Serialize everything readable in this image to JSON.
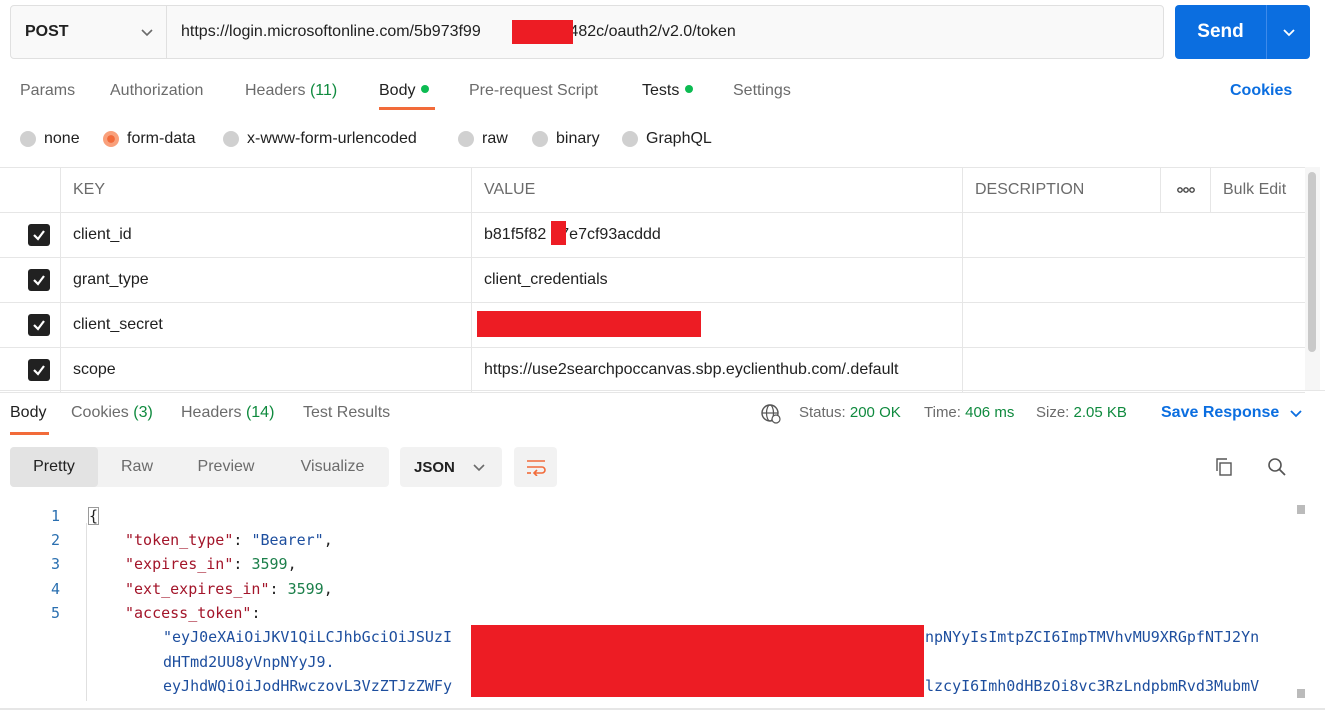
{
  "request": {
    "method": "POST",
    "url_prefix": "https://login.microsoftonline.com/5b973f99",
    "url_suffix": "0b8482c/oauth2/v2.0/token",
    "send_label": "Send"
  },
  "tabs": {
    "params": "Params",
    "authorization": "Authorization",
    "headers": "Headers",
    "headers_count": "(11)",
    "body": "Body",
    "prerequest": "Pre-request Script",
    "tests": "Tests",
    "settings": "Settings",
    "cookies": "Cookies"
  },
  "body_types": {
    "none": "none",
    "form_data": "form-data",
    "urlencoded": "x-www-form-urlencoded",
    "raw": "raw",
    "binary": "binary",
    "graphql": "GraphQL",
    "selected": "form-data"
  },
  "table": {
    "headers": {
      "key": "KEY",
      "value": "VALUE",
      "description": "DESCRIPTION",
      "more": "ooo",
      "bulk_edit": "Bulk Edit"
    },
    "rows": [
      {
        "key": "client_id",
        "value_prefix": "b81f5f82",
        "value_suffix": "7e7cf93acddd",
        "checked": true
      },
      {
        "key": "grant_type",
        "value": "client_credentials",
        "checked": true
      },
      {
        "key": "client_secret",
        "value": "",
        "checked": true
      },
      {
        "key": "scope",
        "value": "https://use2searchpoccanvas.sbp.eyclienthub.com/.default",
        "checked": true
      }
    ]
  },
  "response": {
    "tabs": {
      "body": "Body",
      "cookies": "Cookies",
      "cookies_count": "(3)",
      "headers": "Headers",
      "headers_count": "(14)",
      "test_results": "Test Results"
    },
    "status_label": "Status:",
    "status_value": "200 OK",
    "time_label": "Time:",
    "time_value": "406 ms",
    "size_label": "Size:",
    "size_value": "2.05 KB",
    "save_response": "Save Response",
    "views": {
      "pretty": "Pretty",
      "raw": "Raw",
      "preview": "Preview",
      "visualize": "Visualize"
    },
    "format": "JSON",
    "code": {
      "line_numbers": [
        "1",
        "2",
        "3",
        "4",
        "5"
      ],
      "open_brace": "{",
      "l2_key": "\"token_type\"",
      "l2_val": "\"Bearer\"",
      "l3_key": "\"expires_in\"",
      "l3_val": "3599",
      "l4_key": "\"ext_expires_in\"",
      "l4_val": "3599",
      "l5_key": "\"access_token\"",
      "token_a1": "\"eyJ0eXAiOiJKV1QiLCJhbGciOiJSUzI",
      "token_a2": "npNYyIsImtpZCI6ImpTMVhvMU9XRGpfNTJ2Yn",
      "token_b": "dHTmd2UU8yVnpNYyJ9.",
      "token_c1": "eyJhdWQiOiJodHRwczovL3VzZTJzZWFy",
      "token_c2": "lzcyI6Imh0dHBzOi8vc3RzLndpbmRvd3MubmV"
    }
  },
  "colors": {
    "accent": "#f26b3a",
    "send": "#0b6ee0",
    "success": "#0f8a3e",
    "redaction": "#ed1c24"
  }
}
